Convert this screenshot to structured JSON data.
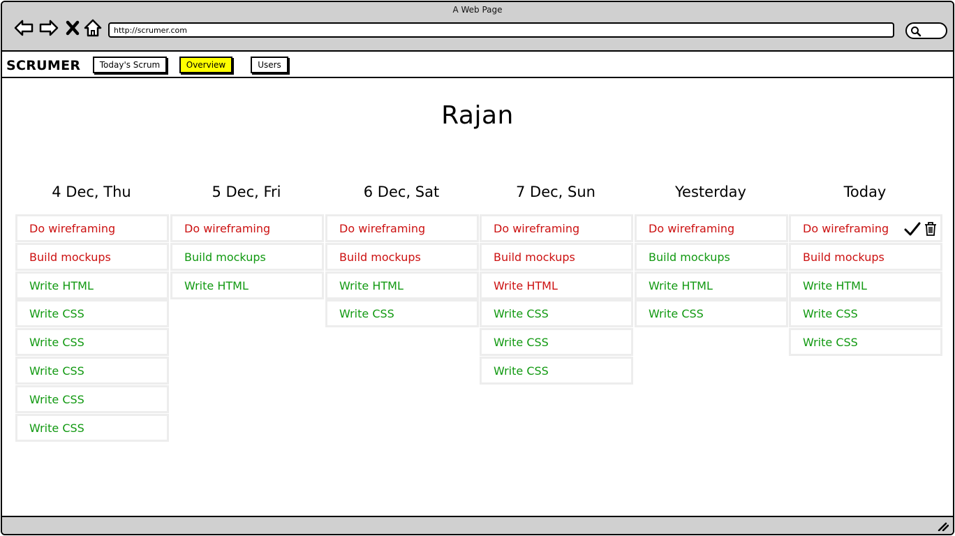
{
  "window": {
    "title": "A Web Page"
  },
  "browser": {
    "url": "http://scrumer.com",
    "icons": [
      "back-arrow-icon",
      "forward-arrow-icon",
      "close-x-icon",
      "home-icon",
      "search-icon"
    ]
  },
  "app": {
    "brand": "SCRUMER",
    "nav": [
      {
        "label": "Today's Scrum",
        "active": false
      },
      {
        "label": "Overview",
        "active": true
      },
      {
        "label": "Users",
        "active": false
      }
    ],
    "accent_color": "#ffff00"
  },
  "page": {
    "title": "Rajan"
  },
  "status_colors": {
    "pending": "#cc1111",
    "done": "#119911"
  },
  "columns": [
    {
      "heading": "4 Dec, Thu",
      "tasks": [
        {
          "label": "Do wireframing",
          "status": "pending"
        },
        {
          "label": "Build mockups",
          "status": "pending"
        },
        {
          "label": "Write HTML",
          "status": "done"
        },
        {
          "label": "Write CSS",
          "status": "done"
        },
        {
          "label": "Write CSS",
          "status": "done"
        },
        {
          "label": "Write CSS",
          "status": "done"
        },
        {
          "label": "Write CSS",
          "status": "done"
        },
        {
          "label": "Write CSS",
          "status": "done"
        }
      ]
    },
    {
      "heading": "5 Dec, Fri",
      "tasks": [
        {
          "label": "Do wireframing",
          "status": "pending"
        },
        {
          "label": "Build mockups",
          "status": "done"
        },
        {
          "label": "Write HTML",
          "status": "done"
        }
      ]
    },
    {
      "heading": "6 Dec, Sat",
      "tasks": [
        {
          "label": "Do wireframing",
          "status": "pending"
        },
        {
          "label": "Build mockups",
          "status": "pending"
        },
        {
          "label": "Write HTML",
          "status": "done"
        },
        {
          "label": "Write CSS",
          "status": "done"
        }
      ]
    },
    {
      "heading": "7 Dec, Sun",
      "tasks": [
        {
          "label": "Do wireframing",
          "status": "pending"
        },
        {
          "label": "Build mockups",
          "status": "pending"
        },
        {
          "label": "Write HTML",
          "status": "pending"
        },
        {
          "label": "Write CSS",
          "status": "done"
        },
        {
          "label": "Write CSS",
          "status": "done"
        },
        {
          "label": "Write CSS",
          "status": "done"
        }
      ]
    },
    {
      "heading": "Yesterday",
      "tasks": [
        {
          "label": "Do wireframing",
          "status": "pending"
        },
        {
          "label": "Build mockups",
          "status": "done"
        },
        {
          "label": "Write HTML",
          "status": "done"
        },
        {
          "label": "Write CSS",
          "status": "done"
        }
      ]
    },
    {
      "heading": "Today",
      "tasks": [
        {
          "label": "Do wireframing",
          "status": "pending",
          "actions": [
            "checkmark-icon",
            "trash-icon"
          ]
        },
        {
          "label": "Build mockups",
          "status": "pending"
        },
        {
          "label": "Write HTML",
          "status": "done"
        },
        {
          "label": "Write CSS",
          "status": "done"
        },
        {
          "label": "Write CSS",
          "status": "done"
        }
      ]
    }
  ]
}
